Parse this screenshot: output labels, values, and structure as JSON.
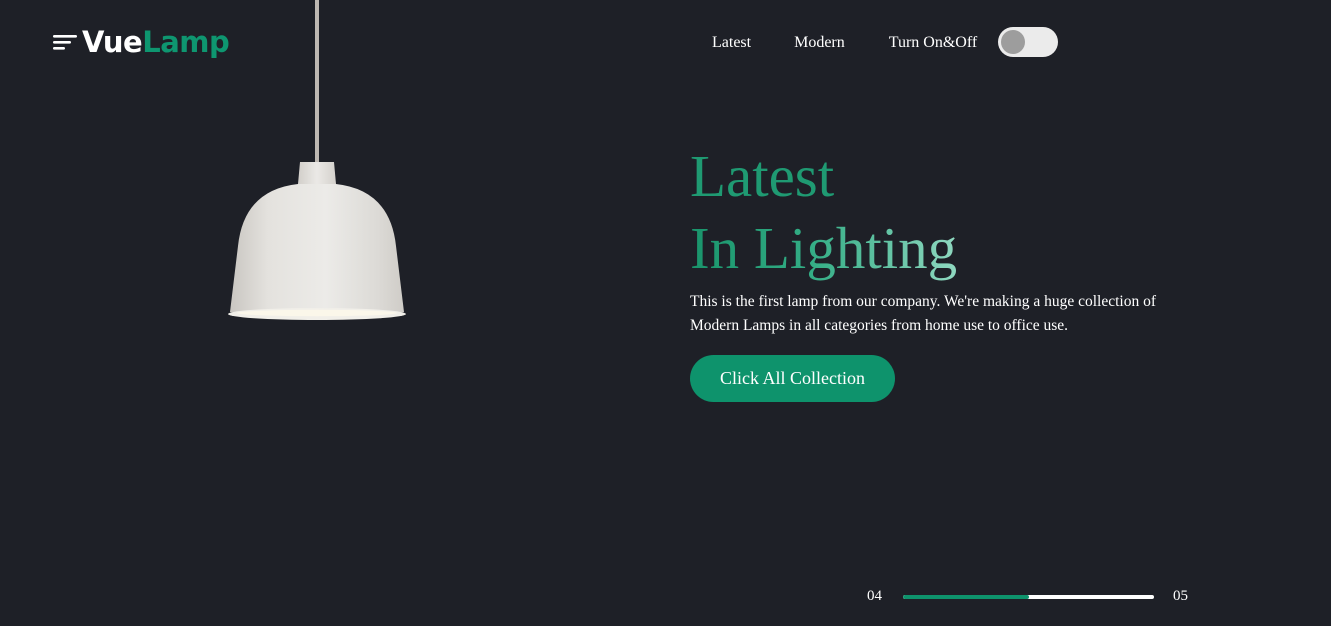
{
  "header": {
    "menu_icon": "hamburger-menu-icon",
    "logo": {
      "part1": "Vue",
      "part2": "Lamp",
      "part1_color": "#ffffff",
      "part2_color": "#0e9670"
    },
    "nav": {
      "items": [
        {
          "label": "Latest"
        },
        {
          "label": "Modern"
        },
        {
          "label": "Turn On&Off"
        }
      ]
    },
    "toggle": {
      "state": "off"
    }
  },
  "lamp_image": "pendant-lamp-illustration",
  "hero": {
    "title_line1": "Latest",
    "title_line2": "In Lighting",
    "description": "This is the first lamp from our company. We're making a huge collection of Modern Lamps in all categories from home use to office use.",
    "cta_label": "Click All Collection"
  },
  "slider": {
    "current": "04",
    "total": "05",
    "progress": 0.5
  },
  "colors": {
    "background": "#1e2027",
    "accent": "#0e936c"
  }
}
